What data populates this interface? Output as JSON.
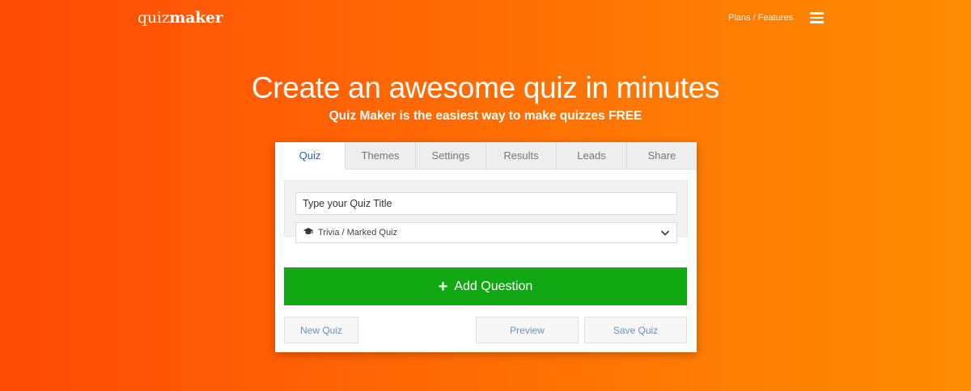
{
  "nav": {
    "logo_light": "quiz",
    "logo_bold": "maker",
    "plans_link": "Plans / Features",
    "menu_icon": "hamburger-menu-icon"
  },
  "hero": {
    "title": "Create an awesome quiz in minutes",
    "subtitle": "Quiz Maker is the easiest way to make quizzes FREE"
  },
  "editor": {
    "tabs": [
      {
        "label": "Quiz",
        "active": true
      },
      {
        "label": "Themes"
      },
      {
        "label": "Settings"
      },
      {
        "label": "Results"
      },
      {
        "label": "Leads"
      },
      {
        "label": "Share"
      }
    ],
    "title_input": {
      "value": "",
      "placeholder": "Type your Quiz Title"
    },
    "quiz_type": {
      "selected": "Trivia / Marked Quiz",
      "icon": "graduation-cap-icon"
    },
    "add_question_label": "Add Question",
    "buttons": {
      "new_quiz": "New Quiz",
      "preview": "Preview",
      "save_quiz": "Save Quiz"
    }
  },
  "colors": {
    "gradient_start": "#ff4a06",
    "gradient_end": "#ff8d02",
    "add_button": "#12a814",
    "active_tab_text": "#2a63b5",
    "secondary_button_text": "#6b8fc0"
  }
}
